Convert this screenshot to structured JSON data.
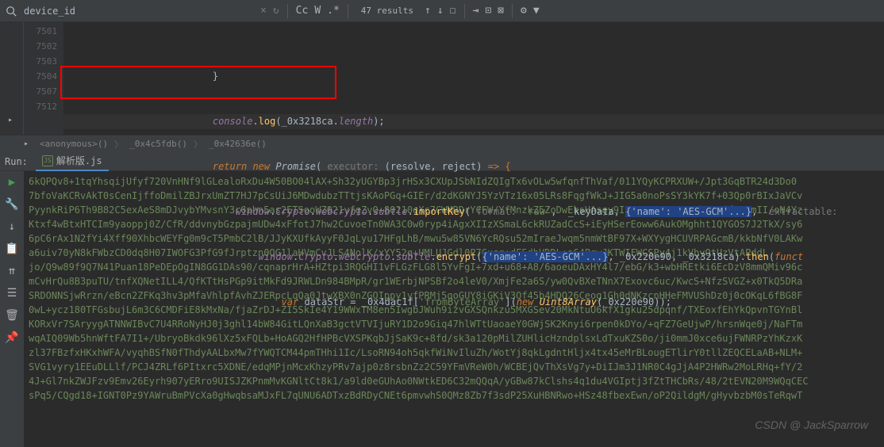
{
  "search": {
    "value": "device_id",
    "results": "47 results"
  },
  "lineNumbers": [
    "7501",
    "7502",
    "7503",
    "7504",
    "7507",
    "7512",
    ""
  ],
  "code": {
    "l1_indent": "                          }",
    "l2": {
      "indent": "                          ",
      "console": "console",
      "log": "log",
      "arg": "_0x3218ca",
      "prop": "length"
    },
    "l3": {
      "indent": "                          ",
      "return": "return",
      "new": "new",
      "promise": "Promise",
      "hint": "executor:",
      "params": "(resolve, reject)",
      "arrow": "=> {"
    },
    "l4": {
      "indent": "                              ",
      "window": "window",
      "crypto": "Crypto",
      "webcrypto": "webcrypto",
      "subtle": "subtle",
      "importKey": "importKey",
      "hint": "format:",
      "raw": "'raw'",
      "keyData": "_keyData",
      "obj": "{'name': 'AES-GCM'...}",
      "hint2": "extractable:"
    },
    "l5": {
      "indent": "                                  ",
      "window": "window",
      "crypto": "Crypto",
      "webcrypto": "webcrypto",
      "subtle": "subtle",
      "encrypt": "encrypt",
      "obj": "{'name': 'AES-GCM'...}",
      "a1": "_0x220e90",
      "a2": "_0x3218ca",
      "then": "then",
      "func": "funct"
    },
    "l6": {
      "indent": "                                      ",
      "var": "var",
      "dataStr": "dataStr",
      "eq": " = ",
      "v1": "_0x4dac1f",
      "key": "'fromByteArray'",
      "new": "new",
      "uint": "Uint8Array",
      "arg": "_0x220e90"
    }
  },
  "breadcrumb": {
    "a": "<anonymous>()",
    "b": "_0x4c5fdb()",
    "c": "_0x42636e()"
  },
  "run": {
    "label": "Run:",
    "tab": "解析版.js"
  },
  "output": [
    "6kQPQv8+1tqYhsqijUfyf720VnHNf9lGLealoRxDu4W50BO04lAX+Sh32yUGYBp3jrHSx3CXUpJSbNIdZQIgTx6vOLw5wfqnfThVaf/011YQyKCPRXUW+/Jpt3GqBTR24d3Do0",
    "7bfoVaKCRvAkT0sCenIjffoDmilZBJrxUmZT7HJ7pCsUiJ6MDwdubzTTtjsKAoPGq+GIEr/d2dKGNYJ5YzVTz16x05LRs8FqgfWkJ+JIG5a0noPsSY3kYK7f+03Qp0rBIxJaVCv",
    "PyynkRiP6Th9B82C5exAeS8mDJvybYMvsnY3r6phn5as2ETSooWZ021vfgZvQ+80210qXc7CWMRDrYCFW/YfMnzkZ5ZoDwEksHAsgy9I607ySBKetE3YvbnSMjfPe8mII/oN4Yz",
    "Ktxf4wBtxHTCIm9yaoppj0Z/CfR/ddvnybGzpajmUDw4xFfotJ7hw2CuvoeTn0WA3C0w0ryp4iAgxXIIzXSmaL6ckRUZadCcS+iEyHSerEoww6AukOMghht1QYGOS7J2TkX/sy6",
    "6pC6rAx1N2fYi4Xff90XhbcWEYFg0m9cT5PmbC2lB/JJyKXUfkAyyF0JqLyu17HFgLhB/mwu5w85VN6YcRQsu52mIraeJwqm5nmWtBF97X+WXYygHCUVRPAGcmB/kkbNfV0LAKw",
    "a6uiv70yN8kFWbzCD0dq8H07IWOFG3PfG9fJrptzn0QG1laHVmCvJLS4NolK/xYY52q+UMLUJGdl0P7Gusq+dF5dbVDDL+a64PqwJKTWIFWCSPy4j1kVbyOtUzVtAPddL",
    "jo/Q9w89f9Q7N41Puan18PeDEpOgIN8GG1DAs90/cqnaprHrA+HZtpi3RQGHI1vFLGzFLG8l5YvFgI+7xd+u68+A8/6aoeuDAxHY4l7/ebG/k3+wbHREtki6EcDzV8mmQMiv96c",
    "mCvHrQu8B3puTU/tnfXQNetILL4/QfKTtHsPGp9itMkFd9JRWLDn984BMpR/gr1WErbjNPSBf2o4leV0/XmjFe2a6S/yw0QvBXeTNnX7Exovc6uc/KwcS+NfzSVGZ+x0TkQ5DRa",
    "SRDONNSjwRrzn/eBcn2ZFKq3hv3pMfaVhlpfAvhZJERpcLqQa0JtwXBX0nZGQIppy1yfPRMj5qoGUY8iGKiV3Qf45b4HDQ26Ceog1Gh0dNKzcnHHeFMVUShDz0j0cOKqL6fBG8F",
    "0wL+ycz180TFGsbujL6m3C6CMDFiE8kMxNa/fjaZrDJ+ZI5SkIe4Y19WWxTM8en5IwgbJWuh9izvGXSQnkzu5MXGSev20MkNtuU6kfX1gku25dpqnf/TXEoxfEhYkQpvnTGYnBl",
    "KORxVr7SAryygATNNWIBvC7U4RRoNyHJ0j3ghl14bW84GitLQnXaB3gctVTVIjuRY1D2o9Giq47hlWTtUaoaeY0GWjSK2Knyi6rpen0kDYo/+qFZ7GeUjwP/hrsnWqe0j/NaFTm",
    "wqAIQ09Wb5hnWftFA7I1+/UbryoBkdk96lXz5xFQLb+HoAGQ2HfHPBcVXSPKqbJjSaK9c+8fd/sk3a120pMilZUHlicHzndplsxLdTxuKZS0o/ji0mmJ0xce6ujFWNRPzYhKzxK",
    "zl37FBzfxHKxhWFA/vyqhBSfN0fThdyAALbxMw7fYWQTCM44pmTHhi1Ic/LsoRN94oh5qkfWiNvIluZh/WotYj8qkLgdntHljx4tx45eMrBLougETlirY0tllZEQCELaAB+NLM+",
    "SVG1vyry1EEuDLLlf/PCJ4ZRLf6PItxrc5XDNE/edqMPjnMcxKhzyPRv7ajp0z8rsbnZz2C59YFmVReW0h/WCBEjQvThXsVg7y+DiIJm3J1NR0C4gJjA4P2HWRw2MoLRHq+fY/2",
    "4J+Gl7nkZWJFzv9Emv26Eyrh907yERro9UISJZKPnmMvKGNltCt8k1/a9ld0eGUhAo0NWtkED6C32mQQqA/yGBw87kClshs4q1du4VGIptj3fZtTHCbRs/48/2tEVN20M9WQqCEC",
    "sPq5/CQgd18+IGNT0Pz9YAWruBmPVcXa0gHwqbsaMJxFL7qUNU6ADTxzBdRDyCNEt6pmvwhS0QMz8Zb7f3sdP25XuHBNRwo+HSz48fbexEwn/oP2QildgM/gHyvbzbM0sTeRqwT"
  ],
  "watermark": "CSDN @ JackSparrow"
}
